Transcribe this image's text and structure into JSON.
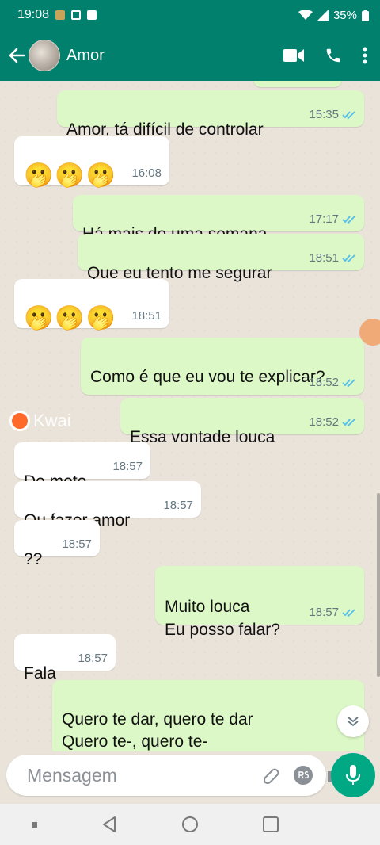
{
  "status_bar": {
    "time": "19:08",
    "battery": "35%"
  },
  "header": {
    "contact_name": "Amor"
  },
  "messages": [
    {
      "text": "Amor, tá difícil de controlar",
      "time": "15:35"
    },
    {
      "text": "🫢🫢🫢",
      "time": "16:08"
    },
    {
      "text": "Há mais de uma semana",
      "time": "17:17"
    },
    {
      "text": "Que eu tento me segurar",
      "time": "18:51"
    },
    {
      "text": "🫢🫢🫢",
      "time": "18:51"
    },
    {
      "text": "Como é que eu vou te explicar?",
      "time": "18:52"
    },
    {
      "text": "Essa vontade louca",
      "time": "18:52"
    },
    {
      "text": "De mete",
      "time": "18:57"
    },
    {
      "text": "Ou fazer amor",
      "time": "18:57"
    },
    {
      "text": "??",
      "time": "18:57"
    },
    {
      "text": "Muito louca\nEu posso falar?",
      "time": "18:57"
    },
    {
      "text": "Fala",
      "time": "18:57"
    },
    {
      "text": "Quero te dar, quero te dar\nQuero te-, quero te-\nQuero te dar, quero te dar",
      "time": ""
    }
  ],
  "watermark": {
    "text": "Kwai"
  },
  "composer": {
    "placeholder": "Mensagem"
  },
  "colors": {
    "header": "#00806d",
    "outgoing": "#dcf8c6",
    "incoming": "#ffffff",
    "read_ticks": "#53bdeb",
    "mic": "#00a884"
  }
}
